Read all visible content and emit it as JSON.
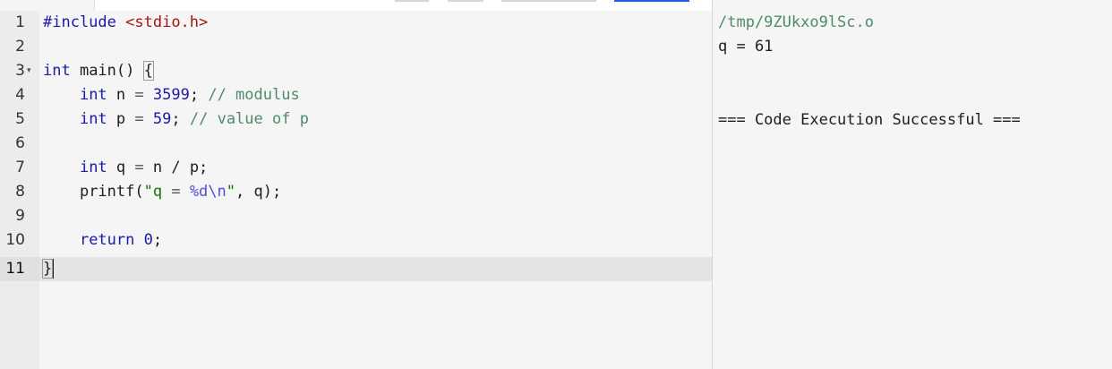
{
  "editor": {
    "line_numbers": [
      "1",
      "2",
      "3",
      "4",
      "5",
      "6",
      "7",
      "8",
      "9",
      "10",
      "11"
    ],
    "active_line": 11,
    "code": {
      "l1_include": "#include",
      "l1_header": "<stdio.h>",
      "l3_kw": "int",
      "l3_sig": " main() ",
      "l3_brace": "{",
      "l4_kw": "int",
      "l4_mid": " n ",
      "l4_eq": "=",
      "l4_num": "3599",
      "l4_semi": ";",
      "l4_cmt": "// modulus",
      "l5_kw": "int",
      "l5_mid": " p ",
      "l5_eq": "=",
      "l5_num": "59",
      "l5_semi": ";",
      "l5_cmt": "// value of p",
      "l7_kw": "int",
      "l7_mid": " q ",
      "l7_eq": "=",
      "l7_rest": " n / p;",
      "l8_fn": "printf(",
      "l8_q1": "\"q ",
      "l8_eq": "=",
      "l8_fmt": " %d\\n",
      "l8_q2": "\"",
      "l8_rest": ", q);",
      "l10_kw": "return",
      "l10_num": " 0",
      "l10_semi": ";",
      "l11_brace": "}"
    }
  },
  "output": {
    "path": "/tmp/9ZUkxo9lSc.o",
    "result": "q = 61",
    "status": "=== Code Execution Successful ==="
  },
  "colors": {
    "keyword": "#1a1aa6",
    "header_string": "#a31515",
    "comment": "#4f8a6a",
    "primary_button": "#1a66d6"
  }
}
